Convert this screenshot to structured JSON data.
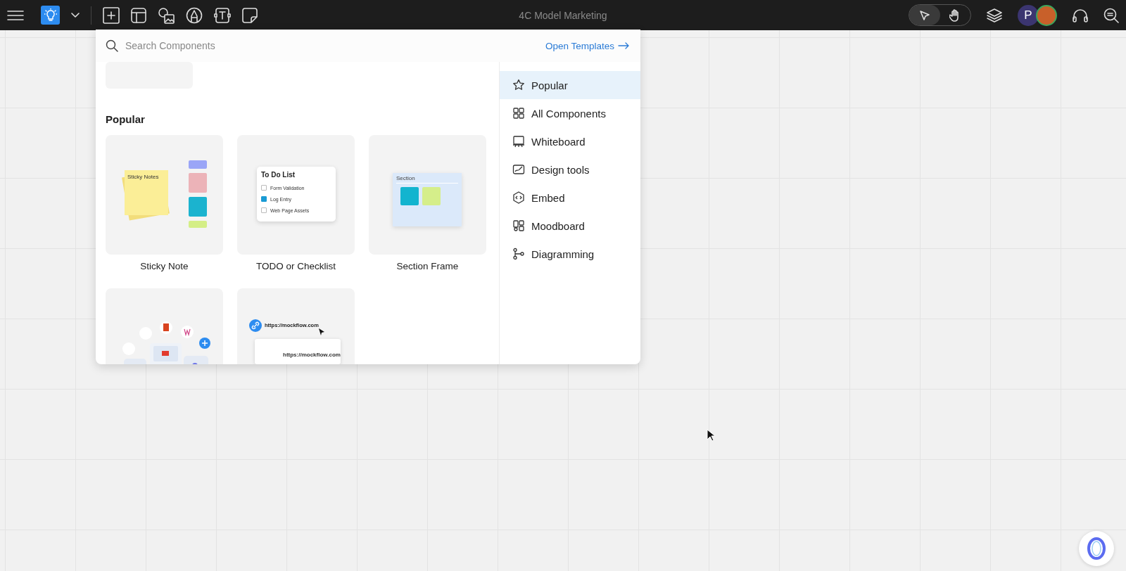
{
  "toolbar": {
    "title": "4C Model Marketing",
    "mode_toggle": [
      {
        "kind": "pointer",
        "selected": true
      },
      {
        "kind": "hand",
        "selected": false
      }
    ],
    "avatar_initial": "P"
  },
  "component_picker": {
    "search": {
      "placeholder": "Search Components"
    },
    "open_templates": "Open Templates",
    "section_title": "Popular",
    "cards": [
      {
        "kind": "sticky",
        "label": "Sticky Note",
        "preview": {
          "note_title": "Sticky Notes"
        }
      },
      {
        "kind": "todo",
        "label": "TODO or Checklist",
        "preview": {
          "title": "To Do List",
          "items": [
            {
              "text": "Form Validation",
              "checked": false
            },
            {
              "text": "Log Entry",
              "checked": true
            },
            {
              "text": "Web Page Assets",
              "checked": false
            }
          ]
        }
      },
      {
        "kind": "section",
        "label": "Section Frame",
        "preview": {
          "title": "Section"
        }
      },
      {
        "kind": "apps"
      },
      {
        "kind": "link",
        "preview": {
          "url": "https://mockflow.com",
          "page_url": "https://mockflow.com"
        }
      }
    ],
    "categories": [
      {
        "kind": "star",
        "label": "Popular",
        "selected": true
      },
      {
        "kind": "grid",
        "label": "All Components",
        "selected": false
      },
      {
        "kind": "board",
        "label": "Whiteboard",
        "selected": false
      },
      {
        "kind": "design",
        "label": "Design tools",
        "selected": false
      },
      {
        "kind": "embed",
        "label": "Embed",
        "selected": false
      },
      {
        "kind": "mood",
        "label": "Moodboard",
        "selected": false
      },
      {
        "kind": "diagram",
        "label": "Diagramming",
        "selected": false
      }
    ]
  }
}
